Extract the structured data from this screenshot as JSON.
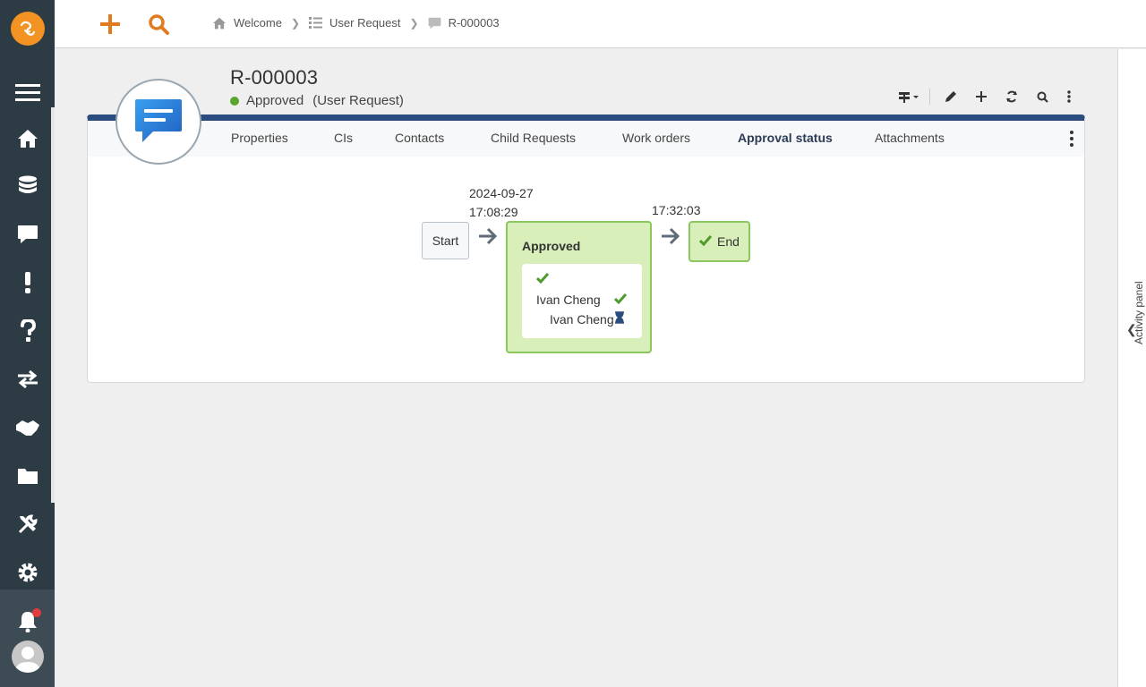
{
  "breadcrumb": [
    {
      "label": "Welcome",
      "icon": "home-icon"
    },
    {
      "label": "User Request",
      "icon": "list-icon"
    },
    {
      "label": "R-000003",
      "icon": "chat-icon"
    }
  ],
  "record": {
    "id": "R-000003",
    "status": "Approved",
    "type": "(User Request)",
    "status_color": "#5aa52e"
  },
  "tabs": [
    {
      "label": "Properties",
      "active": false
    },
    {
      "label": "CIs",
      "active": false
    },
    {
      "label": "Contacts",
      "active": false
    },
    {
      "label": "Child Requests",
      "active": false
    },
    {
      "label": "Work orders",
      "active": false
    },
    {
      "label": "Approval status",
      "active": true
    },
    {
      "label": "Attachments",
      "active": false
    }
  ],
  "workflow": {
    "start_label": "Start",
    "approved_date": "2024-09-27",
    "approved_time": "17:08:29",
    "end_time": "17:32:03",
    "approved_title": "Approved",
    "approvers": [
      {
        "name": "Ivan Cheng",
        "state": "approved"
      },
      {
        "name": "Ivan Cheng",
        "state": "pending"
      }
    ],
    "end_label": "End"
  },
  "activity_panel": {
    "label": "Activity panel"
  },
  "colors": {
    "sidebar": "#2d3b45",
    "accent_orange": "#f39323",
    "card_header": "#2b4c7e",
    "approved_bg": "#d9efb9",
    "approved_border": "#8cc65e"
  }
}
